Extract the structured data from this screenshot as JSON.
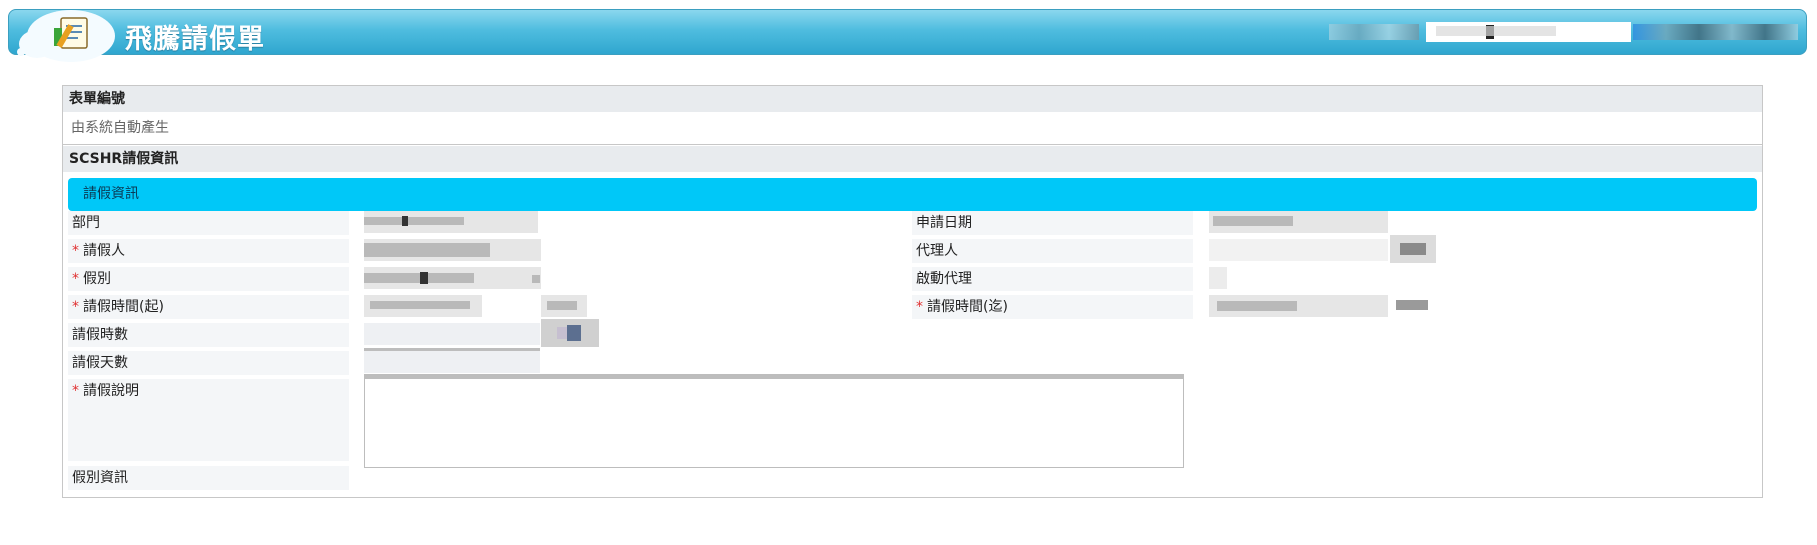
{
  "header": {
    "title": "飛騰請假單"
  },
  "form": {
    "section_form_no": "表單編號",
    "form_no_value": "由系統自動產生",
    "section_leave_info": "SCSHR請假資訊",
    "subsection": "請假資訊",
    "fields": {
      "department": "部門",
      "apply_date": "申請日期",
      "applicant": "請假人",
      "agent": "代理人",
      "leave_type": "假別",
      "activate_agent": "啟動代理",
      "start_time": "請假時間(起)",
      "end_time": "請假時間(迄)",
      "hours": "請假時數",
      "days": "請假天數",
      "description": "請假說明",
      "leave_type_info": "假別資訊"
    },
    "required_mark": "*"
  },
  "colors": {
    "header": "#4fbddf",
    "subbar": "#00c8f8",
    "required": "#e03030"
  }
}
